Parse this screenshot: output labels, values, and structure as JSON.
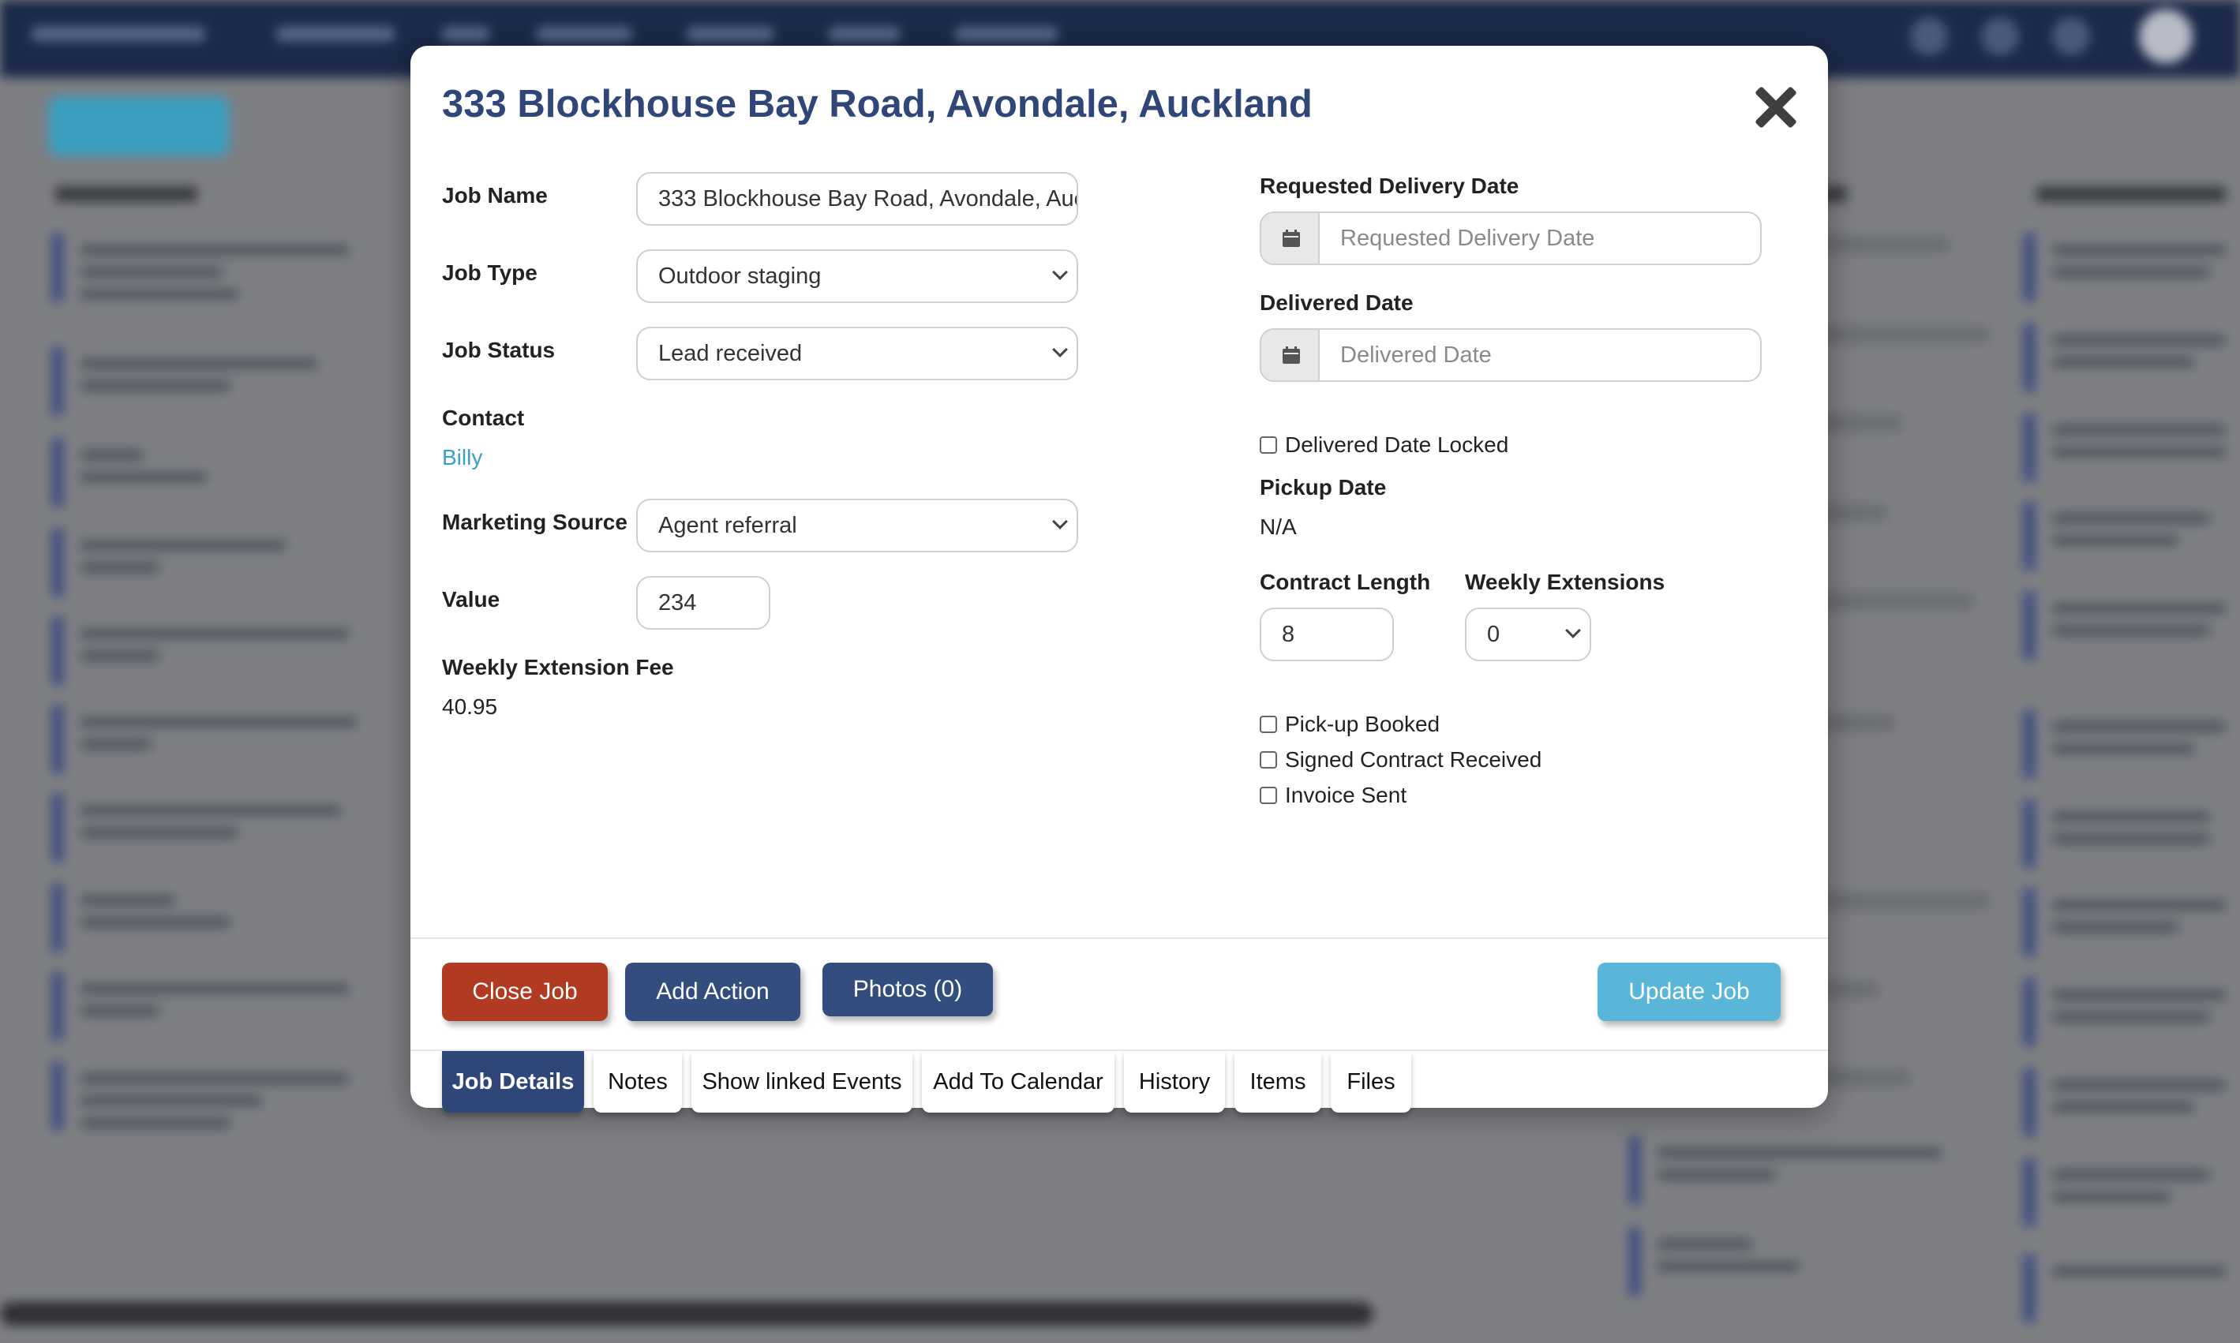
{
  "modal": {
    "title": "333 Blockhouse Bay Road, Avondale, Auckland",
    "left": {
      "job_name_label": "Job Name",
      "job_name_value": "333 Blockhouse Bay Road, Avondale, Auc",
      "job_type_label": "Job Type",
      "job_type_value": "Outdoor staging",
      "job_status_label": "Job Status",
      "job_status_value": "Lead received",
      "contact_label": "Contact",
      "contact_value": "Billy",
      "marketing_source_label": "Marketing Source",
      "marketing_source_value": "Agent referral",
      "value_label": "Value",
      "value_value": "234",
      "weekly_extension_fee_label": "Weekly Extension Fee",
      "weekly_extension_fee_value": "40.95"
    },
    "right": {
      "requested_delivery_label": "Requested Delivery Date",
      "requested_delivery_placeholder": "Requested Delivery Date",
      "delivered_label": "Delivered Date",
      "delivered_placeholder": "Delivered Date",
      "delivered_locked_label": "Delivered Date Locked",
      "pickup_label": "Pickup Date",
      "pickup_value": "N/A",
      "contract_length_label": "Contract Length",
      "contract_length_value": "8",
      "weekly_extensions_label": "Weekly Extensions",
      "weekly_extensions_value": "0",
      "pickup_booked_label": "Pick-up Booked",
      "signed_contract_label": "Signed Contract Received",
      "invoice_sent_label": "Invoice Sent"
    },
    "actions": {
      "close_job": "Close Job",
      "add_action": "Add Action",
      "photos": "Photos (0)",
      "update_job": "Update Job"
    },
    "tabs": [
      {
        "label": "Job Details",
        "active": true
      },
      {
        "label": "Notes"
      },
      {
        "label": "Show linked Events"
      },
      {
        "label": "Add To Calendar"
      },
      {
        "label": "History"
      },
      {
        "label": "Items"
      },
      {
        "label": "Files"
      }
    ]
  },
  "colors": {
    "title": "#2f4678",
    "close_job_button": "#b03a22",
    "navy_button": "#344d7f",
    "update_button": "#5ab6d8",
    "link": "#3aa0cf"
  },
  "icons": {
    "close": "close-icon",
    "calendar": "calendar-icon",
    "select_arrow": "chevron-down-icon"
  }
}
